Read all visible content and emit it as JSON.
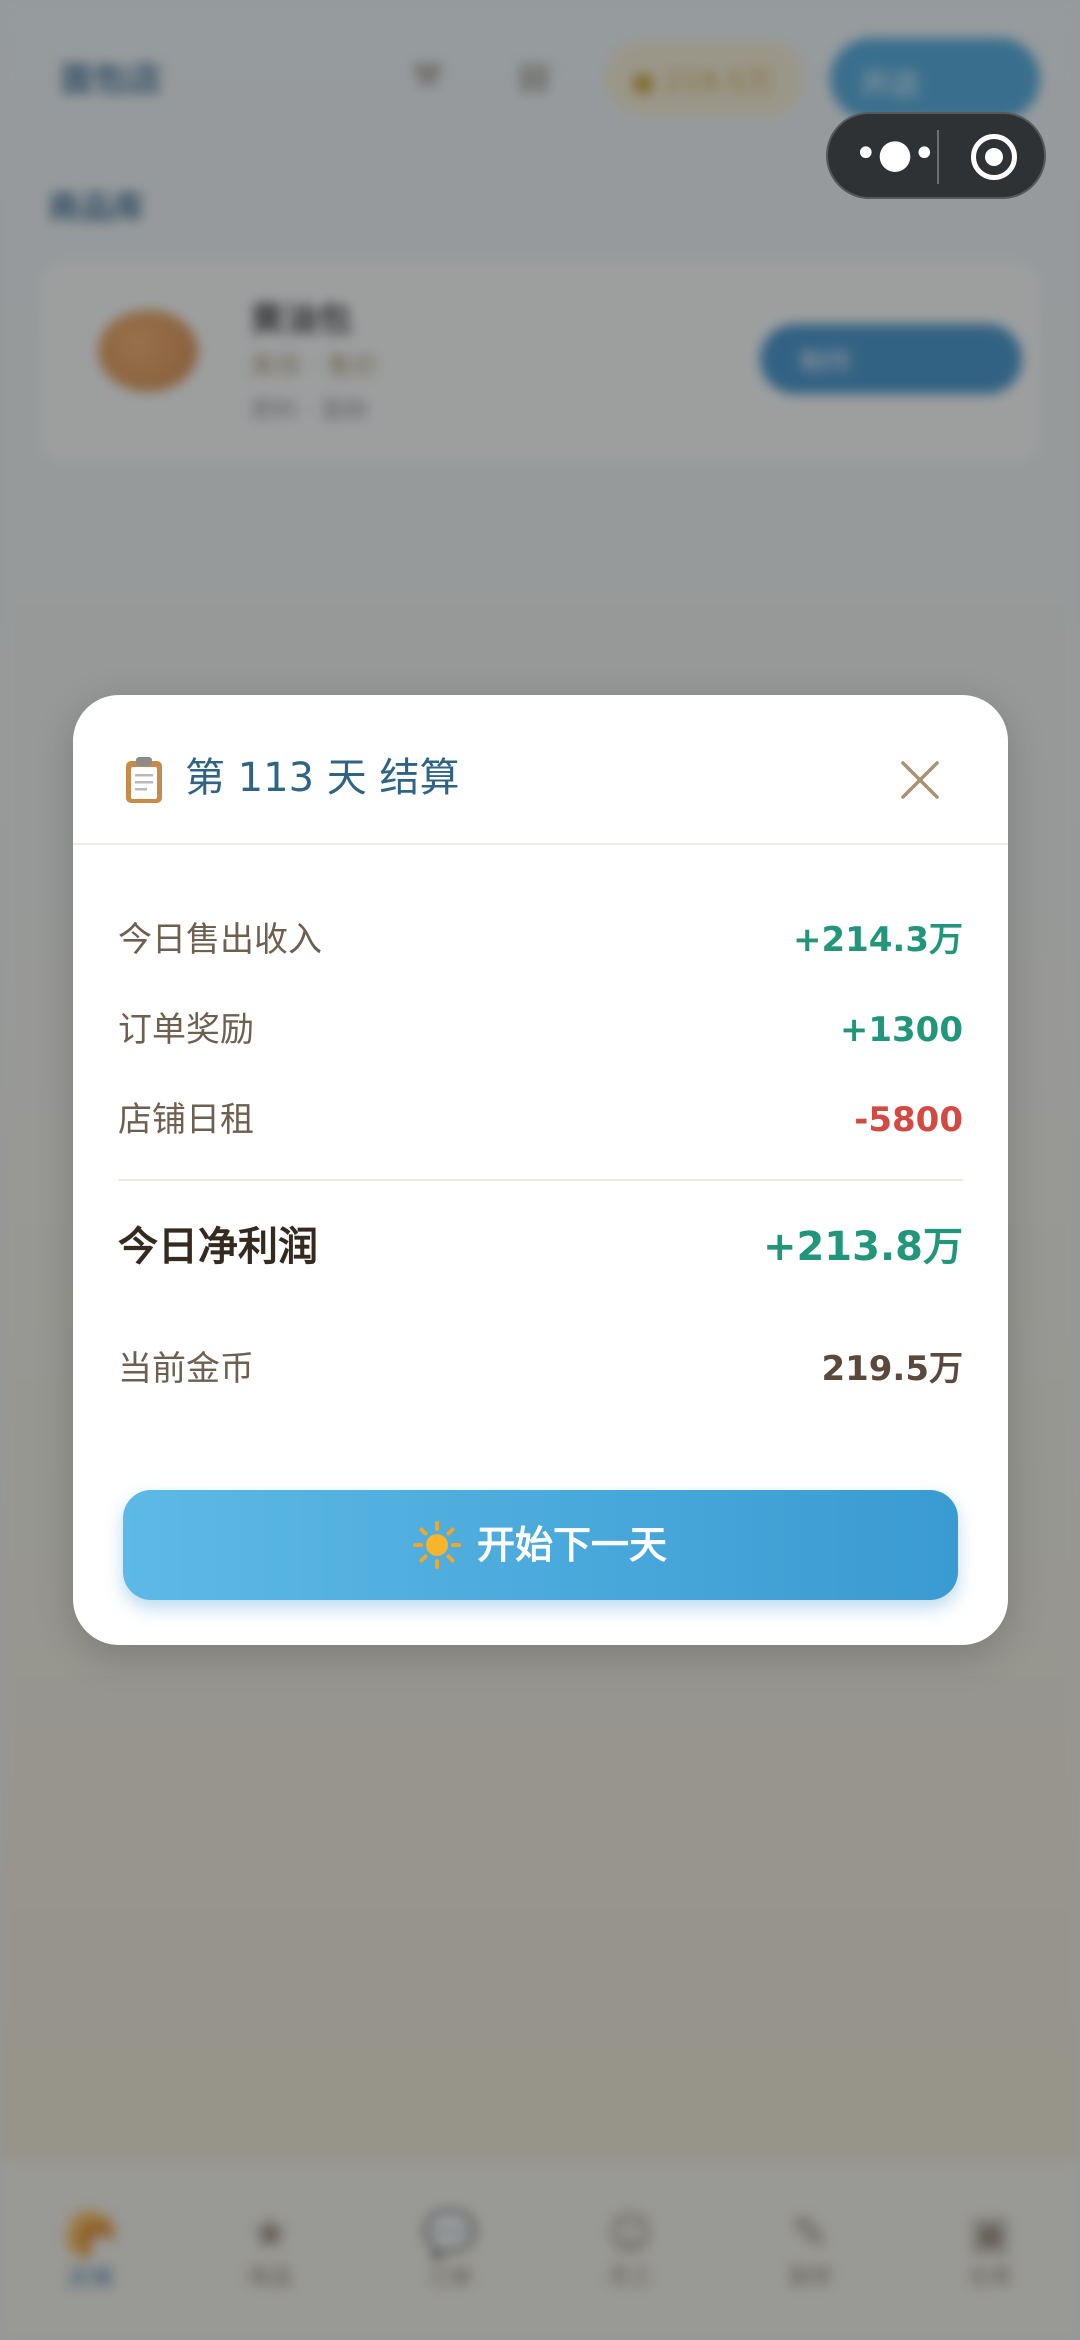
{
  "background": {
    "logo": "面包店",
    "coins": "219.5万",
    "top_action": "开店",
    "section_title": "商品库",
    "product": {
      "name": "黄油包",
      "meta": "库存 · 售价",
      "tags": "原料 · 面粉",
      "action": "制作"
    },
    "nav": [
      "店铺",
      "商品",
      "订单",
      "员工",
      "装修",
      "仓库"
    ]
  },
  "modal": {
    "title": "第 113 天 结算",
    "rows": [
      {
        "label": "今日售出收入",
        "value": "+214.3万"
      },
      {
        "label": "订单奖励",
        "value": "+1300"
      },
      {
        "label": "店铺日租",
        "value": "-5800"
      }
    ],
    "total": {
      "label": "今日净利润",
      "value": "+213.8万"
    },
    "current": {
      "label": "当前金币",
      "value": "219.5万"
    },
    "next_button": "开始下一天"
  },
  "icons": {
    "title_icon": "clipboard-icon",
    "close": "close-icon",
    "button_icon": "sun-icon",
    "capsule_more": "more-dots-icon",
    "capsule_close": "target-icon"
  },
  "colors": {
    "positive": "#22967a",
    "negative": "#d24b43",
    "accent": "#3a9bd2",
    "title": "#2f6485"
  }
}
